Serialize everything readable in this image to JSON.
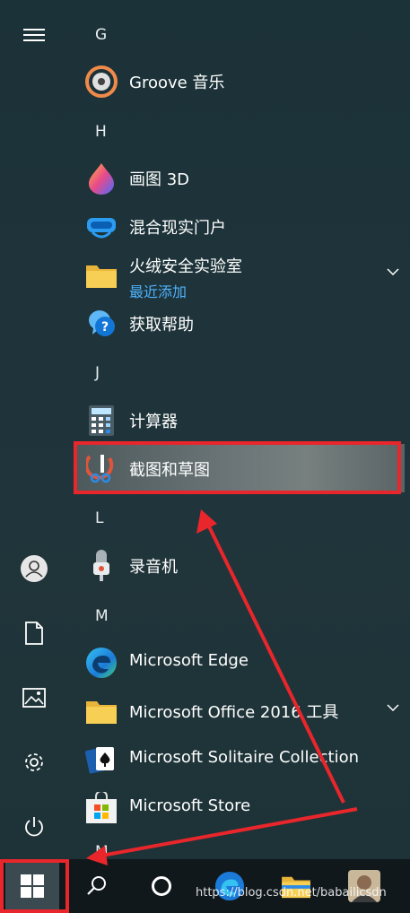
{
  "colors": {
    "accent": "#e8262b",
    "link": "#4fb3ff",
    "background": "#1f3238",
    "taskbar": "#10181c"
  },
  "rail": {
    "menu_icon": "hamburger-icon",
    "items": [
      "user-icon",
      "document-icon",
      "pictures-icon",
      "settings-icon",
      "power-icon"
    ]
  },
  "app_list": {
    "group_g": "G",
    "groove": "Groove 音乐",
    "group_h": "H",
    "paint3d": "画图 3D",
    "mixed_reality": "混合现实门户",
    "huorong_folder": "火绒安全实验室",
    "huorong_sub": "最近添加",
    "get_help": "获取帮助",
    "group_j": "J",
    "calculator": "计算器",
    "snip_sketch": "截图和草图",
    "group_l": "L",
    "recorder": "录音机",
    "group_m": "M",
    "edge": "Microsoft Edge",
    "office_tools": "Microsoft Office 2016 工具",
    "solitaire": "Microsoft Solitaire Collection",
    "store": "Microsoft Store",
    "group_next": "M"
  },
  "taskbar": {
    "items": [
      "windows-start-icon",
      "search-icon",
      "cortana-icon",
      "edge-icon",
      "file-explorer-icon",
      "avatar"
    ]
  },
  "watermark": "https://blog.csdn.net/babailicsdn"
}
